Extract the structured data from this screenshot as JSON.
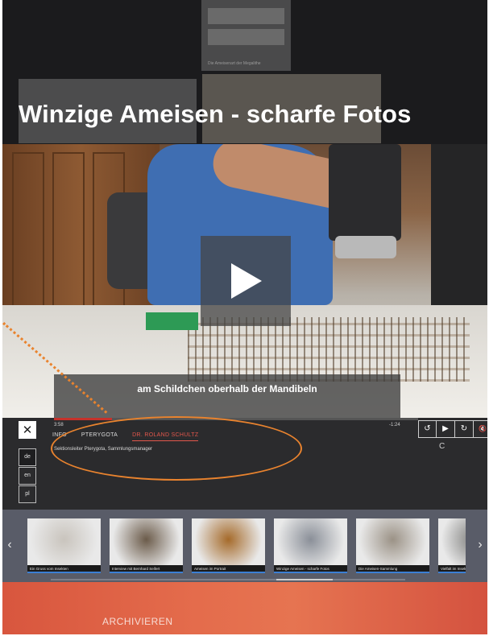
{
  "page": {
    "title": "Winzige Ameisen - scharfe Fotos",
    "background_tile_caption": "Die Ameisenart der Megalithe"
  },
  "video": {
    "subtitle": "am Schildchen oberhalb der Mandibeln",
    "time_current": "3:58",
    "time_remaining": "-1:24",
    "progress_fraction": 0.16
  },
  "info_panel": {
    "tabs": [
      {
        "label": "INFO",
        "active": false
      },
      {
        "label": "PTERYGOTA",
        "active": false
      },
      {
        "label": "DR. ROLAND SCHULTZ",
        "active": true
      }
    ],
    "description": "Sektionsleiter Pterygota, Sammlungsmanager",
    "close_label": "✕"
  },
  "languages": [
    {
      "code": "de",
      "active": true
    },
    {
      "code": "en",
      "active": false
    },
    {
      "code": "pl",
      "active": false
    }
  ],
  "controls": {
    "replay_icon": "↺",
    "play_icon": "▶",
    "forward_icon": "↻",
    "mute_icon": "🔇",
    "loading_glyph": "C"
  },
  "thumbnails": [
    {
      "label": "Ein Gruss vom Insekten",
      "color": "#c9c4bd"
    },
    {
      "label": "Interview mit Bernhard Seifert",
      "color": "#6b5b4a"
    },
    {
      "label": "Ameisen im Portrait",
      "color": "#a56a2a"
    },
    {
      "label": "Winzige Ameisen - scharfe Fotos",
      "color": "#8a8f98"
    },
    {
      "label": "Die Ameisen-Sammlung",
      "color": "#9b9286"
    },
    {
      "label": "Vielfalt im Insekten",
      "color": "#7a7a78"
    }
  ],
  "strip": {
    "prev_icon": "‹",
    "next_icon": "›"
  },
  "footer": {
    "archive_label": "ARCHIVIEREN"
  }
}
